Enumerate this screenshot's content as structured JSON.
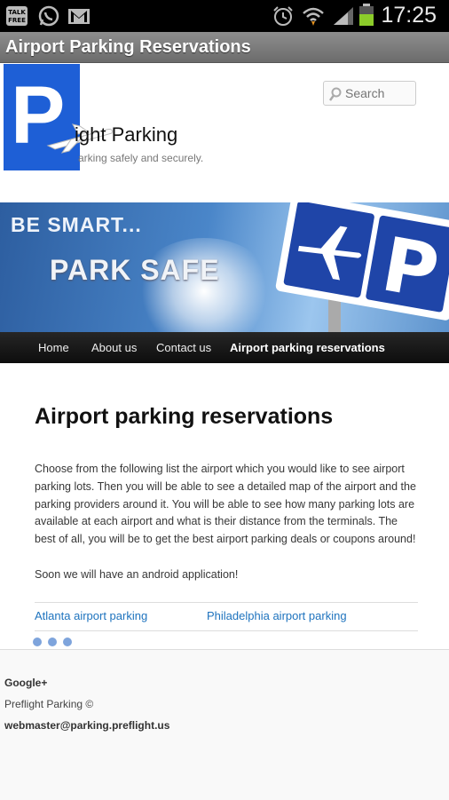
{
  "status_bar": {
    "time": "17:25",
    "icons": [
      "talk-icon",
      "whatsapp-icon",
      "gmail-icon",
      "alarm-icon",
      "wifi-icon",
      "signal-icon",
      "battery-icon"
    ],
    "talk_label": "TALK FREE"
  },
  "app": {
    "title": "Airport Parking Reservations"
  },
  "site": {
    "logo_letter": "P",
    "title": "ight Parking",
    "tagline": "arking safely and securely.",
    "search_placeholder": "Search"
  },
  "banner": {
    "line1": "BE SMART...",
    "line2": "PARK SAFE"
  },
  "nav": {
    "items": [
      {
        "label": "Home"
      },
      {
        "label": "About us"
      },
      {
        "label": "Contact us"
      },
      {
        "label": "Airport parking reservations"
      }
    ],
    "active_index": 3
  },
  "content": {
    "heading": "Airport parking reservations",
    "intro": "Choose from the following list the airport which you would like to see airport parking lots. Then you will be able to see a detailed map of the airport and the parking providers around it. You will be able to see how many parking lots are available at each airport and what is their distance from the terminals. The best of all, you will be to get the best airport parking deals or coupons around!",
    "note": "Soon we will have an android application!",
    "links": [
      {
        "label": "Atlanta airport parking"
      },
      {
        "label": "Philadelphia airport parking"
      }
    ]
  },
  "footer": {
    "google_plus": "Google+",
    "copyright": "Preflight Parking ©",
    "email": "webmaster@parking.preflight.us"
  },
  "colors": {
    "link": "#1e73be",
    "nav_bg": "#1a1a1a",
    "logo_blue": "#1e5fd6",
    "dots": "#7ea4dc"
  }
}
